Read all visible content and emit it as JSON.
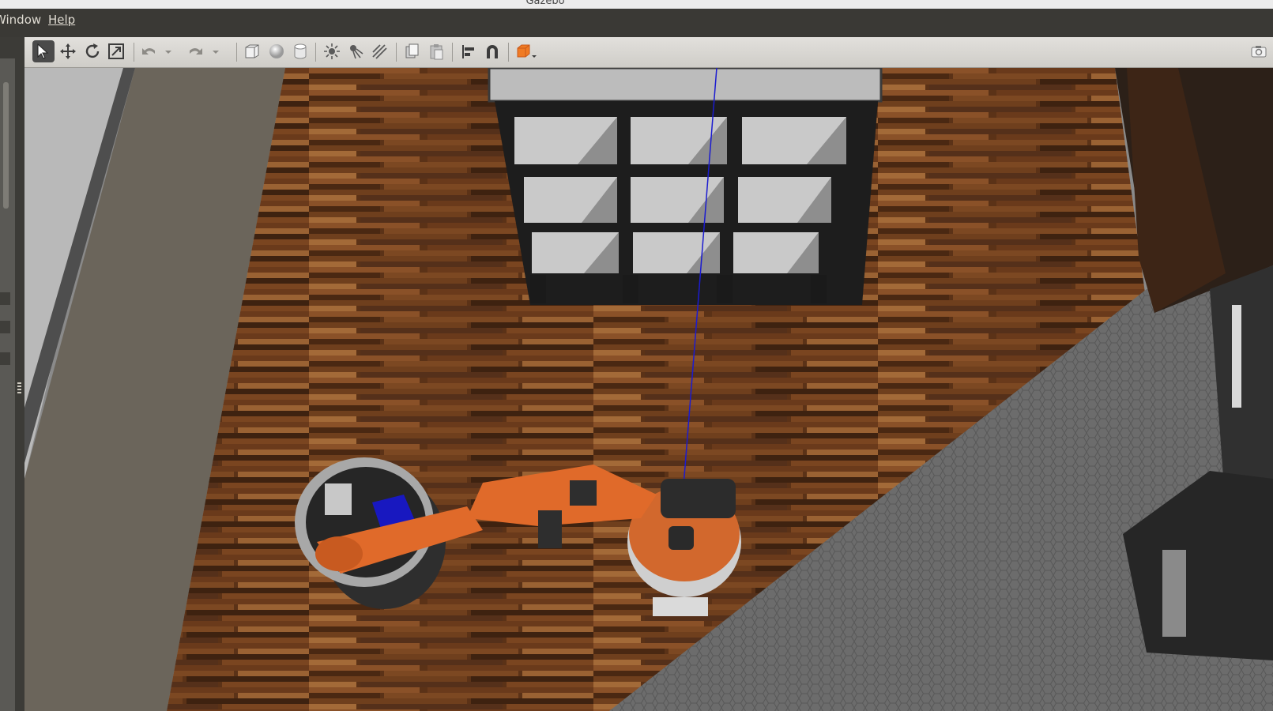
{
  "window": {
    "title": "Gazebo"
  },
  "menu": {
    "items": [
      "Window",
      "Help"
    ]
  },
  "toolbar": {
    "tools": [
      {
        "name": "select-mode",
        "icon": "arrow-cursor-icon",
        "active": true
      },
      {
        "name": "translate-mode",
        "icon": "move-arrows-icon"
      },
      {
        "name": "rotate-mode",
        "icon": "rotate-icon"
      },
      {
        "name": "scale-mode",
        "icon": "scale-icon"
      },
      {
        "name": "undo",
        "icon": "undo-icon"
      },
      {
        "name": "redo",
        "icon": "redo-icon"
      },
      {
        "name": "box-shape",
        "icon": "box-icon"
      },
      {
        "name": "sphere-shape",
        "icon": "sphere-icon"
      },
      {
        "name": "cylinder-shape",
        "icon": "cylinder-icon"
      },
      {
        "name": "point-light",
        "icon": "point-light-icon"
      },
      {
        "name": "spot-light",
        "icon": "spot-light-icon"
      },
      {
        "name": "directional-light",
        "icon": "directional-light-icon"
      },
      {
        "name": "copy",
        "icon": "copy-icon"
      },
      {
        "name": "paste",
        "icon": "paste-icon"
      },
      {
        "name": "align",
        "icon": "align-icon"
      },
      {
        "name": "snap",
        "icon": "magnet-icon"
      },
      {
        "name": "change-view",
        "icon": "view-cube-icon"
      },
      {
        "name": "screenshot",
        "icon": "camera-icon"
      }
    ],
    "accent": "#f07b24"
  },
  "scene": {
    "floor_color": "#6a3d1e",
    "robot_color": "#e06a2a",
    "bin_color": "#a8a8a8",
    "carpet_color": "#6f6f6f"
  }
}
